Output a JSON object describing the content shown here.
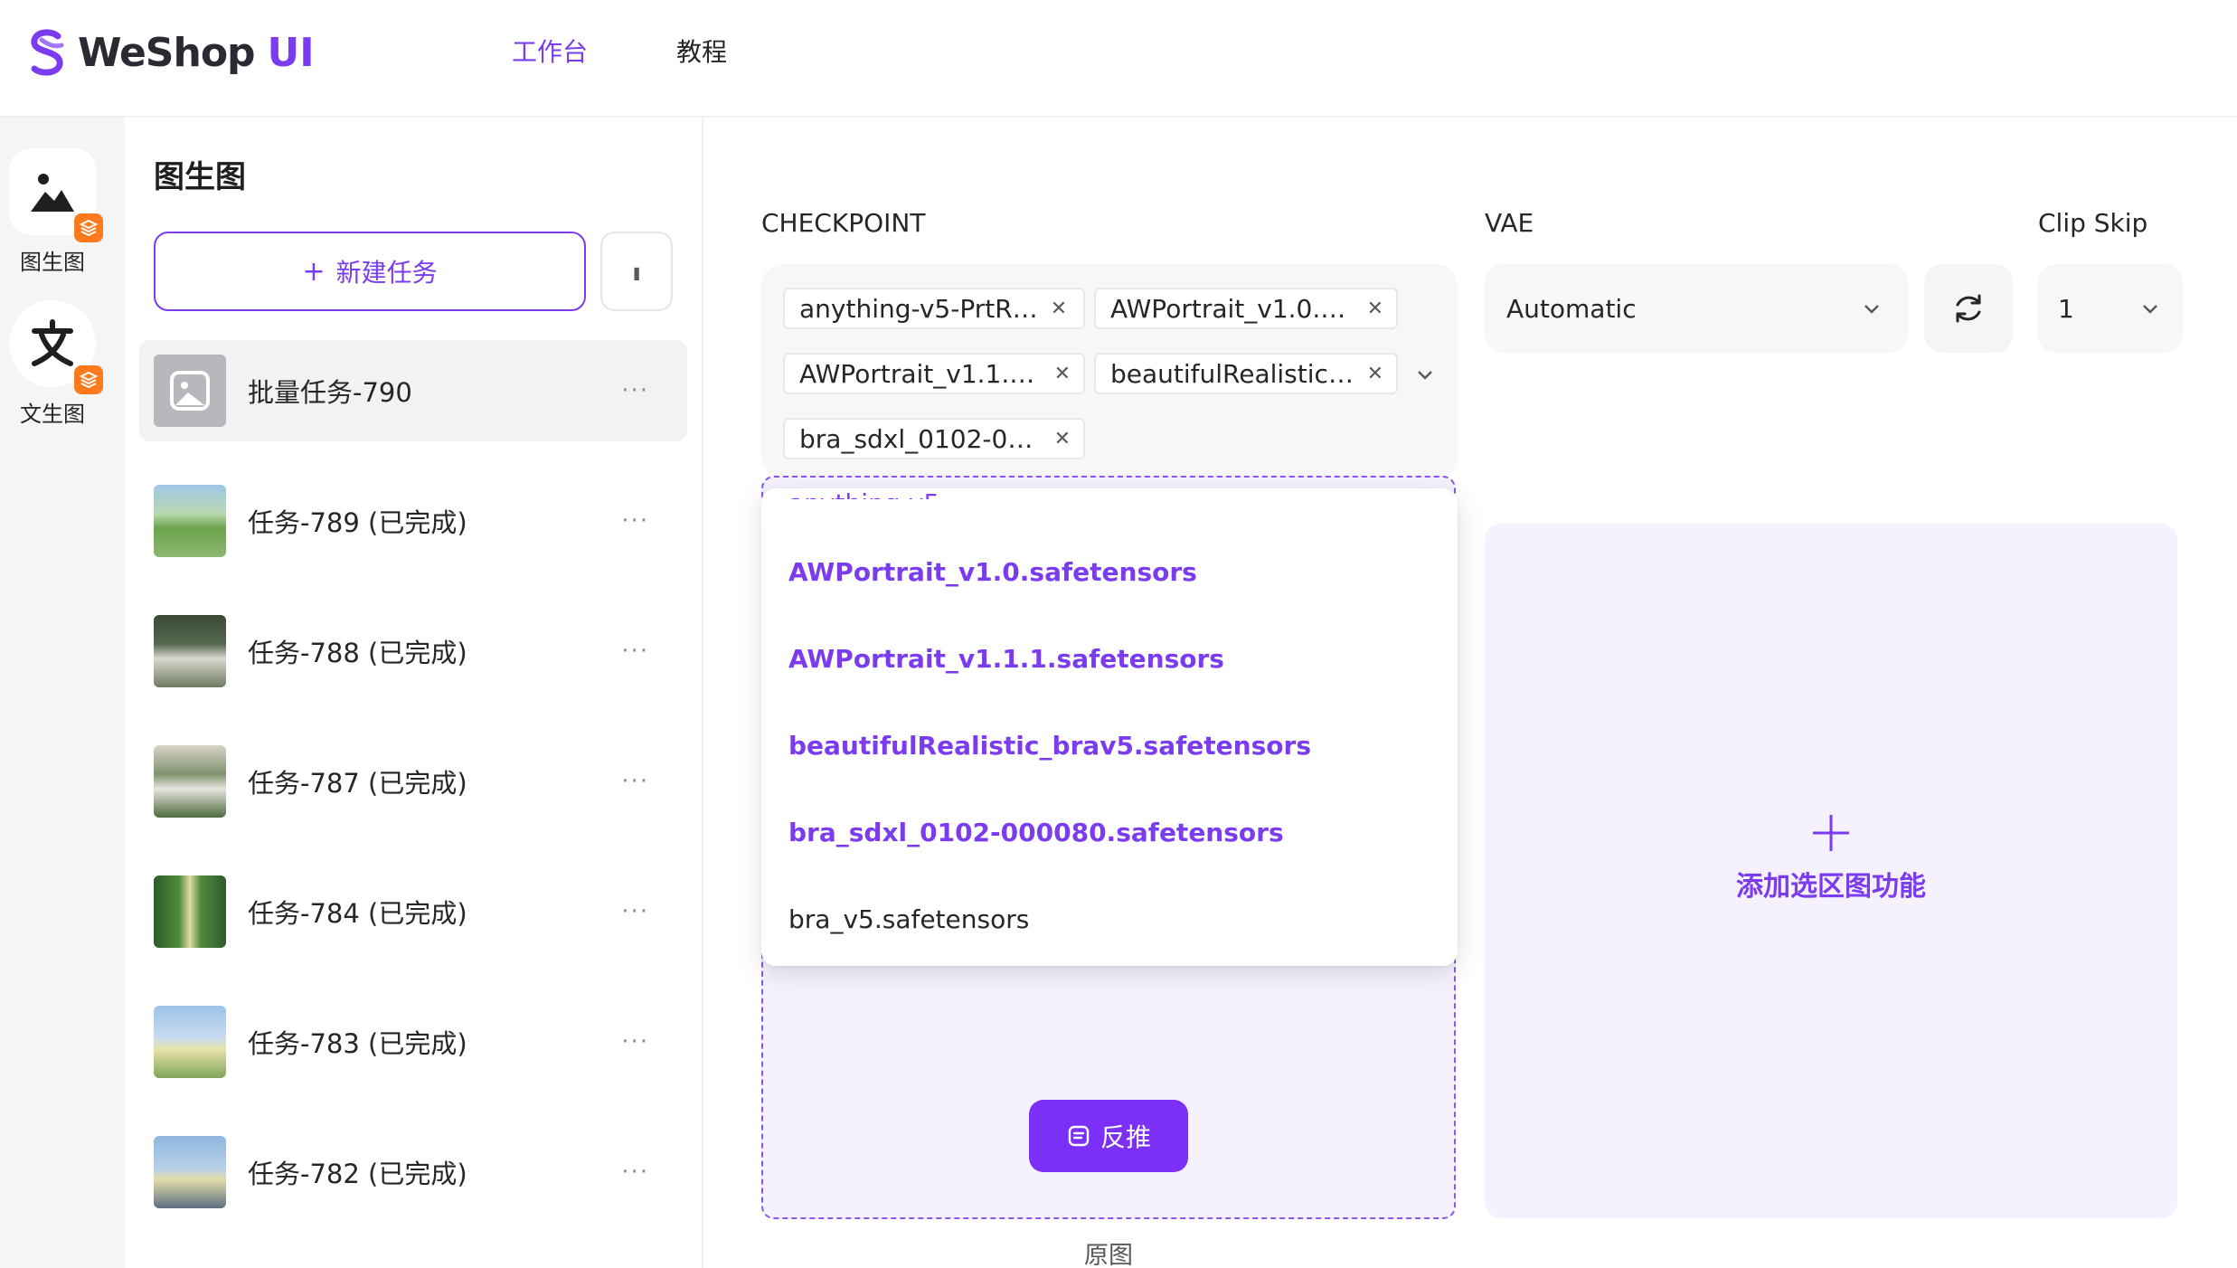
{
  "header": {
    "brand": "WeShop",
    "brand_suffix": "UI",
    "nav": [
      "工作台",
      "教程"
    ]
  },
  "rail": {
    "items": [
      {
        "label": "图生图",
        "icon": "image-icon"
      },
      {
        "label": "文生图",
        "icon": "text-icon"
      }
    ]
  },
  "tasks": {
    "title": "图生图",
    "new_task_label": "新建任务",
    "items": [
      {
        "name": "批量任务-790",
        "active": true
      },
      {
        "name": "任务-789 (已完成)"
      },
      {
        "name": "任务-788 (已完成)"
      },
      {
        "name": "任务-787 (已完成)"
      },
      {
        "name": "任务-784 (已完成)"
      },
      {
        "name": "任务-783 (已完成)"
      },
      {
        "name": "任务-782 (已完成)"
      }
    ]
  },
  "form": {
    "checkpoint_label": "CHECKPOINT",
    "vae_label": "VAE",
    "clip_skip_label": "Clip Skip",
    "checkpoint_tags": [
      "anything-v5-PrtR…",
      "AWPortrait_v1.0.sa…",
      "AWPortrait_v1.1.1.s…",
      "beautifulRealistic_…",
      "bra_sdxl_0102-00…"
    ],
    "vae_value": "Automatic",
    "clip_skip_value": "1"
  },
  "dropdown": {
    "options": [
      {
        "label": "AWPortrait_v1.0.safetensors",
        "selected": true
      },
      {
        "label": "AWPortrait_v1.1.1.safetensors",
        "selected": true
      },
      {
        "label": "beautifulRealistic_brav5.safetensors",
        "selected": true
      },
      {
        "label": "bra_sdxl_0102-000080.safetensors",
        "selected": true
      },
      {
        "label": "bra_v5.safetensors",
        "selected": false
      }
    ]
  },
  "canvas": {
    "invert_label": "反推",
    "orig_caption": "原图",
    "add_label": "添加选区图功能"
  },
  "colors": {
    "accent": "#7b3cf0",
    "badge": "#ff7a1a"
  }
}
